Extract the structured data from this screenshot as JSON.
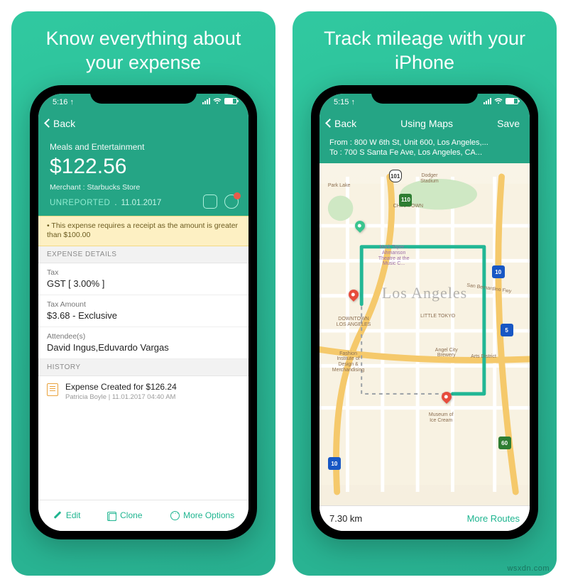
{
  "left": {
    "headline": "Know everything about your expense",
    "status_time": "5:16 ↑",
    "back_label": "Back",
    "expense": {
      "category": "Meals and Entertainment",
      "amount": "$122.56",
      "merchant": "Merchant : Starbucks Store",
      "status": "UNREPORTED",
      "status_sep": " . ",
      "status_date": "11.01.2017",
      "alert_badge": "1"
    },
    "alert": "• This expense requires a receipt as the amount is greater than $100.00",
    "section_details": "EXPENSE DETAILS",
    "rows": {
      "tax_label": "Tax",
      "tax_value": "GST [ 3.00% ]",
      "taxamt_label": "Tax Amount",
      "taxamt_value": "$3.68 - Exclusive",
      "attendee_label": "Attendee(s)",
      "attendee_value": "David Ingus,Eduvardo Vargas"
    },
    "section_history": "HISTORY",
    "history": {
      "title": "Expense Created for $126.24",
      "sub": "Patricia Boyle | 11.01.2017 04:40 AM"
    },
    "bottom": {
      "edit": "Edit",
      "clone": "Clone",
      "more": "More Options"
    }
  },
  "right": {
    "headline": "Track mileage with your iPhone",
    "status_time": "5:15 ↑",
    "back_label": "Back",
    "nav_title": "Using Maps",
    "nav_save": "Save",
    "from": "From : 800 W 6th St, Unit 600, Los Angeles,...",
    "to": "To     : 700 S Santa Fe Ave, Los Angeles, CA...",
    "city": "Los Angeles",
    "pois": {
      "dodger": "Dodger\nStadium",
      "park": "Park Lake",
      "downtown": "DOWNTOWN\nLOS ANGELES",
      "little_tokyo": "LITTLE TOKYO",
      "chinatown": "CHINATOWN",
      "fashion": "Fashion\nInstitute of\nDesign &\nMerchandising",
      "angel": "Angel City\nBrewery",
      "museum": "Museum of\nIce Cream",
      "bernardino": "San Bernardino Fwy",
      "taper": "Mark Taper...\nAhmanson\nTheatre at the\nMusic C...",
      "arts": "Arts District"
    },
    "shields": {
      "us101": "101",
      "ca110": "110",
      "i10a": "10",
      "i10b": "10",
      "ca60": "60",
      "i5": "5"
    },
    "distance": "7.30 km",
    "more_routes": "More Routes"
  },
  "watermark": "wsxdn.com"
}
